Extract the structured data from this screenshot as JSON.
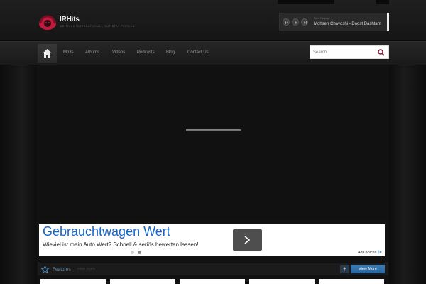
{
  "header": {
    "logo_title": "IRHits",
    "logo_tagline": "WE THINK INTERNATIONAL , BUT STAY PERSIAN",
    "player": {
      "now_playing_label": "Now Playing",
      "track": "Mohsen Chavoshi - Doost Dashtam",
      "icons": [
        "prev-icon",
        "play-icon",
        "next-icon"
      ]
    }
  },
  "nav": {
    "home_icon": "home-icon",
    "items": [
      "Mp3s",
      "Albums",
      "Videos",
      "Podcasts",
      "Blog",
      "Contact Us"
    ],
    "search_placeholder": "Search",
    "search_icon": "search-icon"
  },
  "ad": {
    "title": "Gebrauchtwagen Wert",
    "description": "Wieviel ist mein Auto Wert? Schnell & seriös bewerten lassen!",
    "choices_label": "AdChoices",
    "arrow_icon": "arrow-right-icon"
  },
  "features": {
    "title": "Features",
    "subtitle": "view more",
    "plus_label": "+",
    "view_more_label": "View More",
    "icon": "star-icon"
  },
  "colors": {
    "accent_red": "#c21a3c",
    "accent_blue": "#2e72ad",
    "ad_title_blue": "#1a66c6"
  }
}
